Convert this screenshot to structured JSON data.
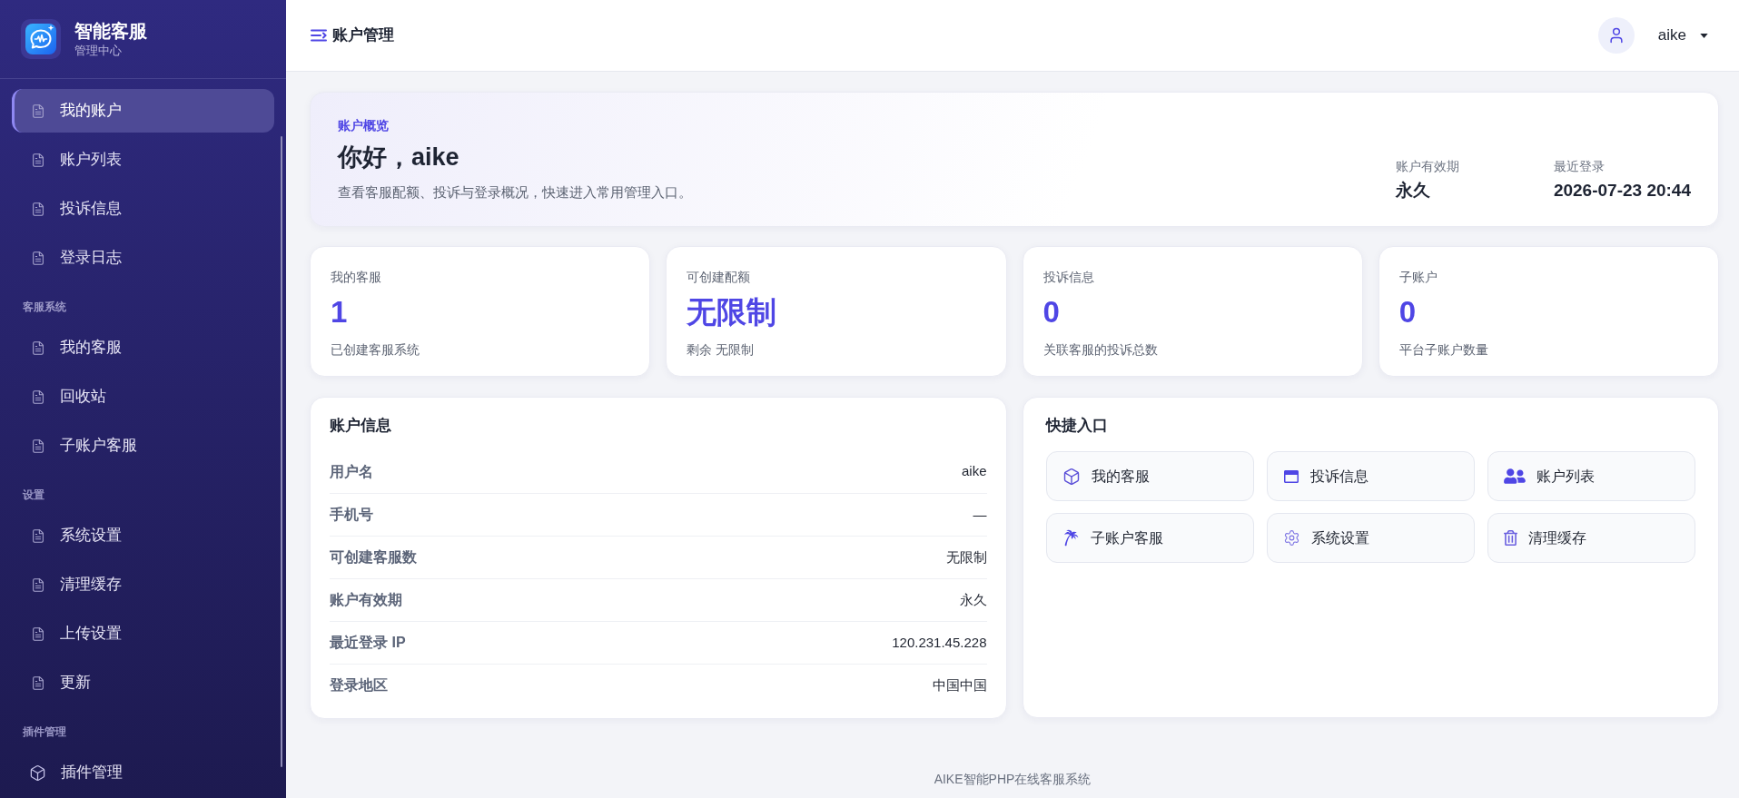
{
  "sidebar": {
    "brand": {
      "title": "智能客服",
      "subtitle": "管理中心"
    },
    "sections": [
      {
        "items": [
          {
            "label": "我的账户",
            "selected": true,
            "kind": "page"
          },
          {
            "label": "账户列表",
            "selected": false,
            "kind": "page"
          },
          {
            "label": "投诉信息",
            "selected": false,
            "kind": "page"
          },
          {
            "label": "登录日志",
            "selected": false,
            "kind": "page"
          }
        ]
      },
      {
        "title": "客服系统",
        "items": [
          {
            "label": "我的客服",
            "selected": false,
            "kind": "page"
          },
          {
            "label": "回收站",
            "selected": false,
            "kind": "page"
          },
          {
            "label": "子账户客服",
            "selected": false,
            "kind": "page"
          }
        ]
      },
      {
        "title": "设置",
        "items": [
          {
            "label": "系统设置",
            "selected": false,
            "kind": "page"
          },
          {
            "label": "清理缓存",
            "selected": false,
            "kind": "page"
          },
          {
            "label": "上传设置",
            "selected": false,
            "kind": "page"
          },
          {
            "label": "更新",
            "selected": false,
            "kind": "page"
          }
        ]
      },
      {
        "title": "插件管理",
        "items": [
          {
            "label": "插件管理",
            "selected": false,
            "kind": "plugin"
          }
        ]
      }
    ]
  },
  "header": {
    "title": "账户管理",
    "user": {
      "name": "aike"
    }
  },
  "overview": {
    "eyebrow": "账户概览",
    "greeting": "你好，aike",
    "description": "查看客服配额、投诉与登录概况，快速进入常用管理入口。",
    "meta": [
      {
        "label": "账户有效期",
        "value": "永久"
      },
      {
        "label": "最近登录",
        "value": "2026-07-23 20:44"
      }
    ]
  },
  "stats": [
    {
      "label": "我的客服",
      "value": "1",
      "note": "已创建客服系统"
    },
    {
      "label": "可创建配额",
      "value": "无限制",
      "note": "剩余 无限制"
    },
    {
      "label": "投诉信息",
      "value": "0",
      "note": "关联客服的投诉总数"
    },
    {
      "label": "子账户",
      "value": "0",
      "note": "平台子账户数量"
    }
  ],
  "account_info": {
    "title": "账户信息",
    "rows": [
      {
        "label": "用户名",
        "value": "aike"
      },
      {
        "label": "手机号",
        "value": "—"
      },
      {
        "label": "可创建客服数",
        "value": "无限制"
      },
      {
        "label": "账户有效期",
        "value": "永久"
      },
      {
        "label": "最近登录 IP",
        "value": "120.231.45.228"
      },
      {
        "label": "登录地区",
        "value": "中国中国"
      }
    ]
  },
  "quick_links": {
    "title": "快捷入口",
    "items": [
      {
        "label": "我的客服",
        "kind": "service"
      },
      {
        "label": "投诉信息",
        "kind": "complaint"
      },
      {
        "label": "账户列表",
        "kind": "accounts"
      },
      {
        "label": "子账户客服",
        "kind": "subaccount"
      },
      {
        "label": "系统设置",
        "kind": "settings"
      },
      {
        "label": "清理缓存",
        "kind": "cache"
      }
    ]
  },
  "footer": "AIKE智能PHP在线客服系统"
}
